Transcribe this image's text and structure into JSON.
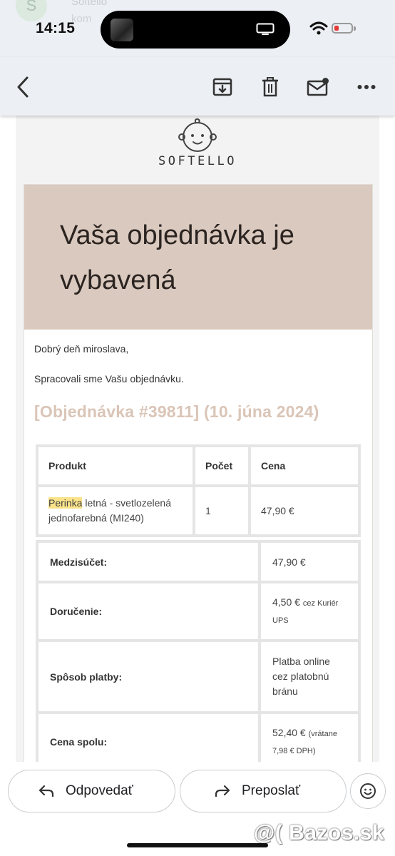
{
  "status_bar": {
    "time": "14:15",
    "ghost_avatar": "S",
    "ghost_sender": "Softello",
    "ghost_preview": "kom"
  },
  "toolbar": {
    "back_icon": "back-arrow-icon",
    "archive_icon": "archive-icon",
    "delete_icon": "trash-icon",
    "mark_unread_icon": "mail-unread-icon",
    "more_icon": "more-horiz-icon"
  },
  "email": {
    "brand": "SOFTELLO",
    "hero_title": "Vaša objednávka je vybavená",
    "greeting": "Dobrý deň miroslava,",
    "processed": "Spracovali sme Vašu objednávku.",
    "order_heading": "[Objednávka #39811] (10. júna 2024)",
    "table": {
      "headers": [
        "Produkt",
        "Počet",
        "Cena"
      ],
      "item": {
        "name_highlight": "Perinka",
        "name_rest": " letná - svetlozelená jednofarebná (MI240)",
        "quantity": "1",
        "price": "47,90 €"
      }
    },
    "totals": {
      "subtotal_label": "Medzisúčet:",
      "subtotal_value": "47,90 €",
      "shipping_label": "Doručenie:",
      "shipping_value": "4,50 €",
      "shipping_note": "cez Kuriér UPS",
      "payment_label": "Spôsob platby:",
      "payment_value": "Platba online cez platobnú bránu",
      "total_label": "Cena spolu:",
      "total_value": "52,40 €",
      "total_note": "(vrátane 7,98 € DPH)"
    }
  },
  "actions": {
    "reply_label": "Odpovedať",
    "forward_label": "Preposlať",
    "emoji_icon": "emoji-smile-icon"
  },
  "watermark": "@( Bazos.sk",
  "colors": {
    "hero_bg": "#dac9bf",
    "order_heading": "#dac5b7",
    "highlight": "#fbe38a",
    "appbar_bg": "#eceff3"
  }
}
